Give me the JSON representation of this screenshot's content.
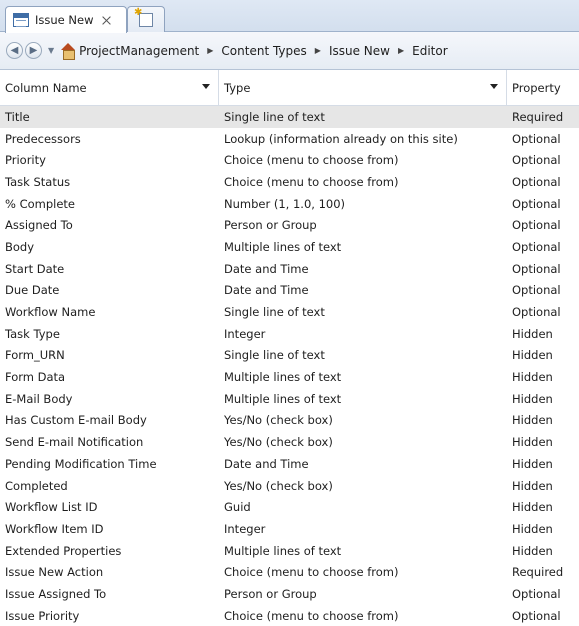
{
  "tabs": [
    {
      "label": "Issue New",
      "icon": "content-type-icon"
    },
    {
      "label": "",
      "icon": "new-tab-icon"
    }
  ],
  "breadcrumb": [
    "ProjectManagement",
    "Content Types",
    "Issue New",
    "Editor"
  ],
  "grid": {
    "headers": [
      "Column Name",
      "Type",
      "Property"
    ],
    "rows": [
      {
        "name": "Title",
        "type": "Single line of text",
        "property": "Required",
        "selected": true
      },
      {
        "name": "Predecessors",
        "type": "Lookup (information already on this site)",
        "property": "Optional"
      },
      {
        "name": "Priority",
        "type": "Choice (menu to choose from)",
        "property": "Optional"
      },
      {
        "name": "Task Status",
        "type": "Choice (menu to choose from)",
        "property": "Optional"
      },
      {
        "name": "% Complete",
        "type": "Number (1, 1.0, 100)",
        "property": "Optional"
      },
      {
        "name": "Assigned To",
        "type": "Person or Group",
        "property": "Optional"
      },
      {
        "name": "Body",
        "type": "Multiple lines of text",
        "property": "Optional"
      },
      {
        "name": "Start Date",
        "type": "Date and Time",
        "property": "Optional"
      },
      {
        "name": "Due Date",
        "type": "Date and Time",
        "property": "Optional"
      },
      {
        "name": "Workflow Name",
        "type": "Single line of text",
        "property": "Optional"
      },
      {
        "name": "Task Type",
        "type": "Integer",
        "property": "Hidden"
      },
      {
        "name": "Form_URN",
        "type": "Single line of text",
        "property": "Hidden"
      },
      {
        "name": "Form Data",
        "type": "Multiple lines of text",
        "property": "Hidden"
      },
      {
        "name": "E-Mail Body",
        "type": "Multiple lines of text",
        "property": "Hidden"
      },
      {
        "name": "Has Custom E-mail Body",
        "type": "Yes/No (check box)",
        "property": "Hidden"
      },
      {
        "name": "Send E-mail Notification",
        "type": "Yes/No (check box)",
        "property": "Hidden"
      },
      {
        "name": "Pending Modification Time",
        "type": "Date and Time",
        "property": "Hidden"
      },
      {
        "name": "Completed",
        "type": "Yes/No (check box)",
        "property": "Hidden"
      },
      {
        "name": "Workflow List ID",
        "type": "Guid",
        "property": "Hidden"
      },
      {
        "name": "Workflow Item ID",
        "type": "Integer",
        "property": "Hidden"
      },
      {
        "name": "Extended Properties",
        "type": "Multiple lines of text",
        "property": "Hidden"
      },
      {
        "name": "Issue New Action",
        "type": "Choice (menu to choose from)",
        "property": "Required"
      },
      {
        "name": "Issue Assigned To",
        "type": "Person or Group",
        "property": "Optional"
      },
      {
        "name": "Issue Priority",
        "type": "Choice (menu to choose from)",
        "property": "Optional"
      }
    ]
  },
  "colors": {
    "selected_row": "#e6e6e6",
    "tab_border": "#8fa3bf"
  }
}
